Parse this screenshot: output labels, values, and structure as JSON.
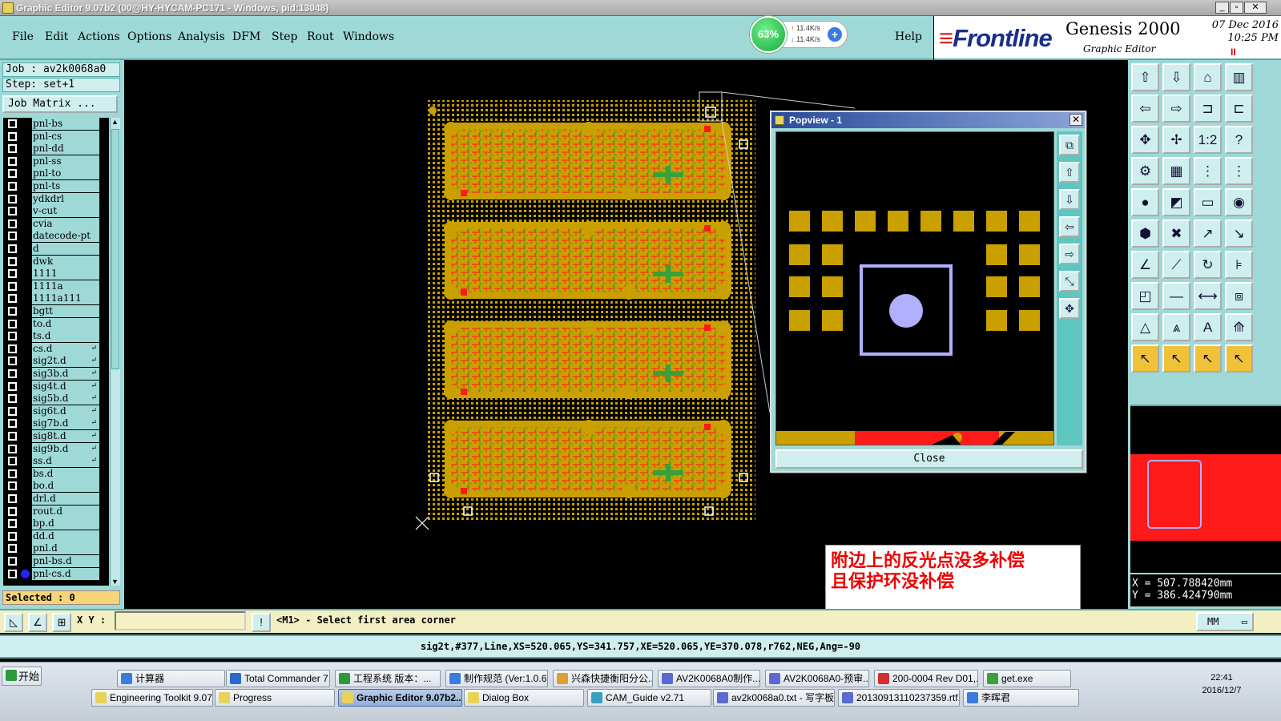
{
  "titlebar": {
    "title": "Graphic Editor 9.07b2 (00@HY-HYCAM-PC171 - Windows, pid:13048)"
  },
  "menu": {
    "items": [
      "File",
      "Edit",
      "Actions",
      "Options",
      "Analysis",
      "DFM",
      "Step",
      "Rout",
      "Windows"
    ],
    "help": "Help"
  },
  "netmon": {
    "percent": "63%",
    "up": "11.4K/s",
    "down": "11.4K/s"
  },
  "brand": {
    "logo": "Frontline",
    "product": "Genesis 2000",
    "subtitle": "Graphic Editor",
    "date": "07 Dec 2016",
    "time": "10:25 PM",
    "pause": "II"
  },
  "job": {
    "job_label": "Job : av2k0068a0",
    "step_label": "Step: set+1",
    "matrix_button": "Job Matrix ...",
    "selected": "Selected : 0"
  },
  "layers": [
    {
      "name": "pnl-bs",
      "mark": ""
    },
    {
      "name": "pnl-cs",
      "mark": ""
    },
    {
      "name": "pnl-dd",
      "mark": ""
    },
    {
      "name": "pnl-ss",
      "mark": ""
    },
    {
      "name": "pnl-to",
      "mark": ""
    },
    {
      "name": "pnl-ts",
      "mark": ""
    },
    {
      "name": "ydkdrl",
      "mark": ""
    },
    {
      "name": "v-cut",
      "mark": ""
    },
    {
      "name": "cvia",
      "mark": ""
    },
    {
      "name": "datecode-pt",
      "mark": ""
    },
    {
      "name": "d",
      "mark": ""
    },
    {
      "name": "dwk",
      "mark": ""
    },
    {
      "name": "1111",
      "mark": ""
    },
    {
      "name": "1111a",
      "mark": ""
    },
    {
      "name": "1111a111",
      "mark": ""
    },
    {
      "name": "bgtt",
      "mark": ""
    },
    {
      "name": "to.d",
      "mark": ""
    },
    {
      "name": "ts.d",
      "mark": ""
    },
    {
      "name": "cs.d",
      "mark": "↵"
    },
    {
      "name": "sig2t.d",
      "mark": "↵"
    },
    {
      "name": "sig3b.d",
      "mark": "↵"
    },
    {
      "name": "sig4t.d",
      "mark": "↵"
    },
    {
      "name": "sig5b.d",
      "mark": "↵"
    },
    {
      "name": "sig6t.d",
      "mark": "↵"
    },
    {
      "name": "sig7b.d",
      "mark": "↵"
    },
    {
      "name": "sig8t.d",
      "mark": "↵"
    },
    {
      "name": "sig9b.d",
      "mark": "↵"
    },
    {
      "name": "ss.d",
      "mark": "↵"
    },
    {
      "name": "bs.d",
      "mark": ""
    },
    {
      "name": "bo.d",
      "mark": ""
    },
    {
      "name": "drl.d",
      "mark": ""
    },
    {
      "name": "rout.d",
      "mark": ""
    },
    {
      "name": "bp.d",
      "mark": ""
    },
    {
      "name": "dd.d",
      "mark": ""
    },
    {
      "name": "pnl.d",
      "mark": ""
    },
    {
      "name": "pnl-bs.d",
      "mark": ""
    },
    {
      "name": "pnl-cs.d",
      "mark": ""
    }
  ],
  "popview": {
    "title": "Popview - 1",
    "close_label": "Close"
  },
  "note": {
    "line1": "附边上的反光点没多补偿",
    "line2": "且保护环没补偿"
  },
  "coords": {
    "x": "X = 507.788420mm",
    "y": "Y = 386.424790mm"
  },
  "cmd": {
    "xy_label": "X Y :",
    "xy_value": "",
    "prompt": "<M1> - Select first area corner",
    "units": "MM"
  },
  "status": {
    "text": "sig2t,#377,Line,XS=520.065,YS=341.757,XE=520.065,YE=370.078,r762,NEG,Ang=-90"
  },
  "taskbar": {
    "start": "开始",
    "row1": [
      "计算器",
      "Total Commander 7...",
      "工程系统  版本：...",
      "制作规范 (Ver:1.0.6)",
      "兴森快捷衡阳分公...",
      "AV2K0068A0制作...",
      "AV2K0068A0-预审...",
      "200-0004 Rev D01,...",
      "get.exe"
    ],
    "row2": [
      "Engineering Toolkit 9.07...",
      "Progress",
      "Graphic Editor 9.07b2...",
      "Dialog Box",
      "CAM_Guide v2.71",
      "av2k0068a0.txt - 写字板",
      "20130913110237359.rtf...",
      "李晖君"
    ],
    "clock_time": "22:41",
    "clock_date": "2016/12/7"
  },
  "colors": {
    "panel": "#9ed9d7",
    "copper": "#c9a000",
    "trace": "#ff1a1a",
    "green": "#3aa03a",
    "pad_ring": "#b0b0ff"
  }
}
